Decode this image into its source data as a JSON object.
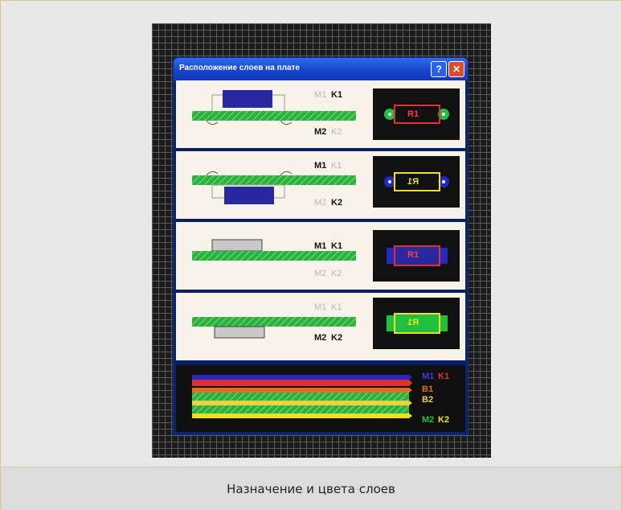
{
  "caption": "Назначение и цвета слоев",
  "dialog": {
    "title": "Расположение слоев на плате",
    "help_label": "?",
    "close_label": "✕"
  },
  "rows": [
    {
      "m": "M1",
      "k": "K1",
      "m2": "M2",
      "k2": "K2",
      "part": "R1"
    },
    {
      "m": "M1",
      "k": "K1",
      "m2": "M2",
      "k2": "K2",
      "part": "R1"
    },
    {
      "m": "M1",
      "k": "K1",
      "m2": "M2",
      "k2": "K2",
      "part": "R1"
    },
    {
      "m": "M1",
      "k": "K1",
      "m2": "M2",
      "k2": "K2",
      "part": "R1"
    }
  ],
  "legend": {
    "m1": "M1",
    "k1": "K1",
    "b1": "B1",
    "b2": "B2",
    "m2": "M2",
    "k2": "K2"
  },
  "colors": {
    "board": "#2bb140",
    "top_pad": "#2828a0",
    "red": "#e03030",
    "yellow": "#f0e020",
    "orange": "#e07020"
  }
}
